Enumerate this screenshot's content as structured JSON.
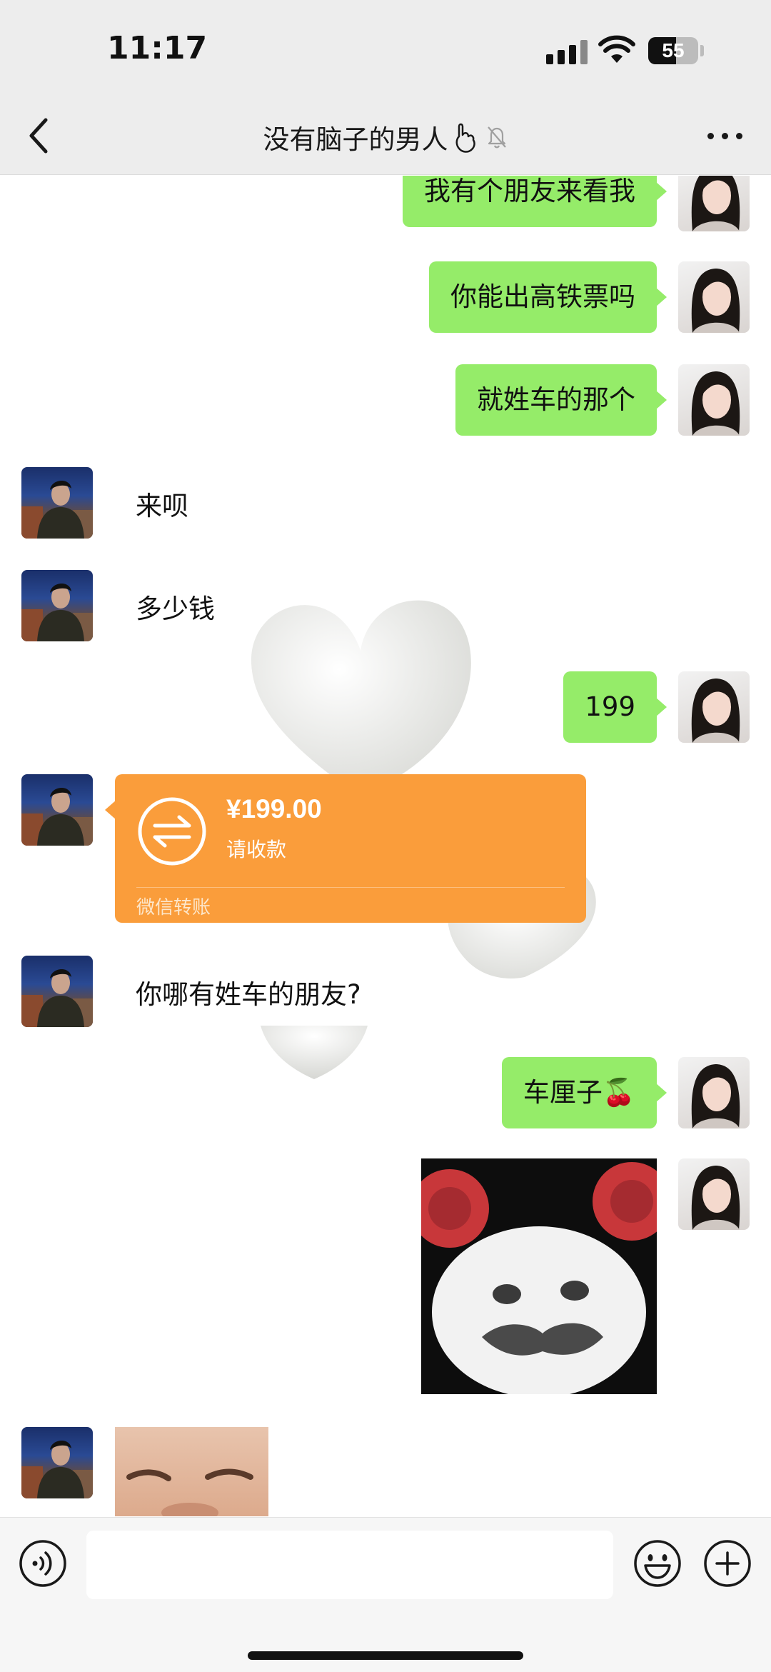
{
  "status_bar": {
    "time": "11:17",
    "battery": "55"
  },
  "header": {
    "title": "没有脑子的男人",
    "back_icon": "chevron-left-icon",
    "more_icon": "ellipsis-icon",
    "title_icons": [
      "hand-emoji-icon",
      "bell-muted-icon"
    ]
  },
  "messages": [
    {
      "from": "me",
      "text": "我有个朋友来看我"
    },
    {
      "from": "me",
      "text": "你能出高铁票吗"
    },
    {
      "from": "me",
      "text": "就姓车的那个"
    },
    {
      "from": "other",
      "text": "来呗"
    },
    {
      "from": "other",
      "text": "多少钱"
    },
    {
      "from": "me",
      "text": "199"
    },
    {
      "from": "other",
      "type": "transfer",
      "amount": "¥199.00",
      "status": "请收款",
      "label": "微信转账"
    },
    {
      "from": "other",
      "text": "你哪有姓车的朋友?"
    },
    {
      "from": "me",
      "text": "车厘子🍒"
    },
    {
      "from": "me",
      "type": "sticker",
      "sticker": "panda-face-sticker"
    },
    {
      "from": "other",
      "type": "sticker",
      "sticker": "crying-baby-sticker"
    }
  ],
  "input_bar": {
    "placeholder": "",
    "voice_icon": "voice-icon",
    "emoji_icon": "emoji-icon",
    "plus_icon": "plus-icon"
  },
  "colors": {
    "outgoing_bubble": "#95ec69",
    "transfer_card": "#fa9d3b",
    "background": "#ffffff",
    "header": "#ededed"
  }
}
